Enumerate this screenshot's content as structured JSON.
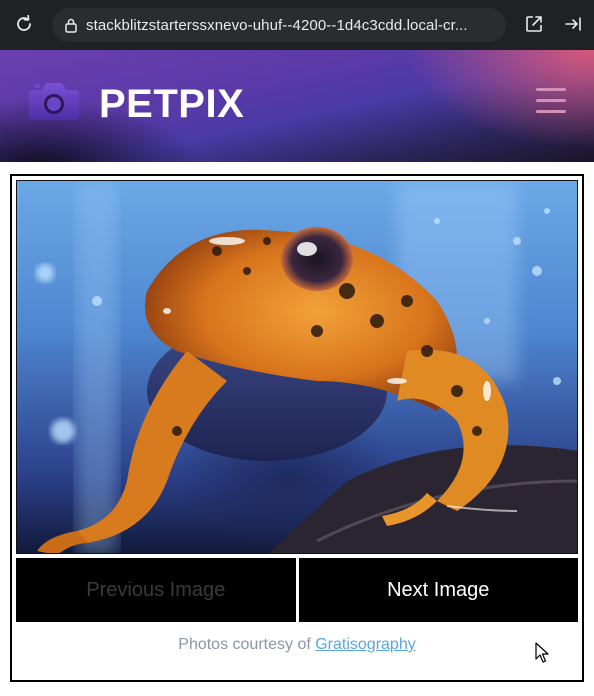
{
  "browser": {
    "url": "stackblitzstarterssxnevo-uhuf--4200--1d4c3cdd.local-cr...",
    "icons": [
      "reload-icon",
      "lock-icon",
      "open-external-icon",
      "sidebar-collapse-icon"
    ]
  },
  "header": {
    "brand": "PETPIX",
    "icons": [
      "camera-icon",
      "hamburger-menu-icon"
    ],
    "colors": {
      "gradient_start": "#6b3fb0",
      "gradient_accent": "#de5a78",
      "menu_icon": "#d58fb4"
    }
  },
  "gallery": {
    "image_subject": "orange frog",
    "prev_label": "Previous Image",
    "next_label": "Next Image",
    "prev_disabled": true
  },
  "footer": {
    "credit_prefix": "Photos courtesy of ",
    "credit_link": "Gratisography"
  }
}
